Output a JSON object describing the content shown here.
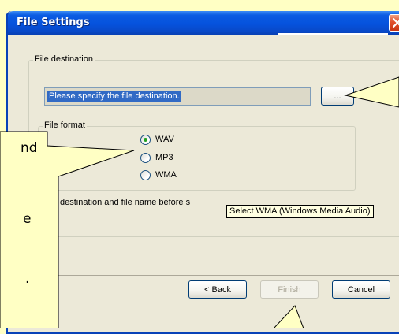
{
  "dialog": {
    "title": "File Settings"
  },
  "destination_group": {
    "label": "File destination",
    "input_value": "Please specify the file destination.",
    "browse_label": "..."
  },
  "format_group": {
    "label": "File format",
    "options": [
      {
        "label": "WAV",
        "selected": true
      },
      {
        "label": "MP3",
        "selected": false
      },
      {
        "label": "WMA",
        "selected": false
      }
    ]
  },
  "instruction_text": "destination and file name before s",
  "tooltip": "Select WMA (Windows Media Audio)",
  "buttons": {
    "back": "< Back",
    "finish": "Finish",
    "cancel": "Cancel"
  },
  "callout": {
    "lines": [
      "nd",
      "e",
      "."
    ]
  },
  "colors": {
    "titlebar": "#0652dd",
    "dialog_bg": "#ece9d8",
    "callout_bg": "#ffffc4",
    "selection": "#316ac5",
    "tooltip_bg": "#ffffe1"
  }
}
